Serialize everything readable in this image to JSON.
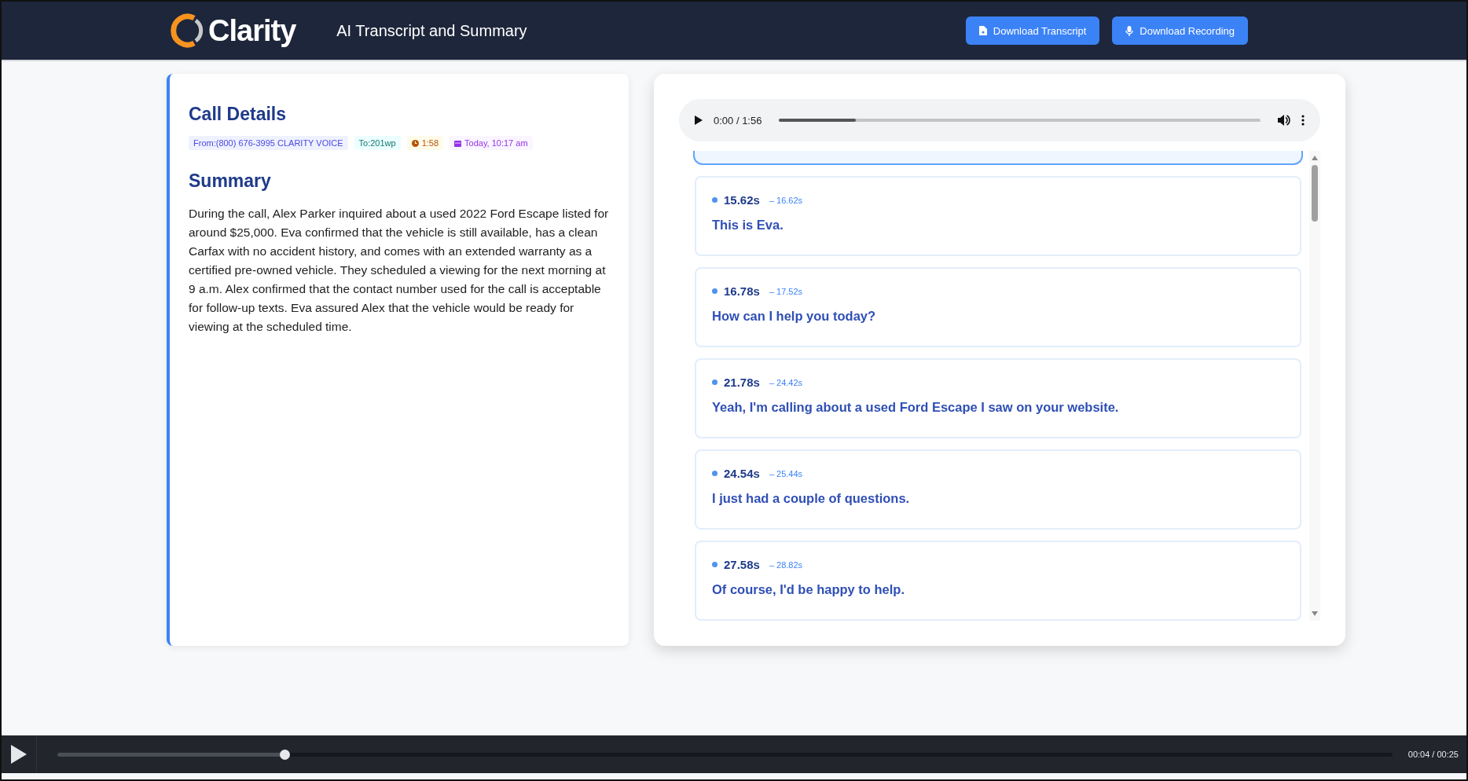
{
  "header": {
    "logo": "Clarity",
    "title": "AI Transcript and Summary",
    "buttons": [
      {
        "kind": "transcript",
        "label": "Download Transcript"
      },
      {
        "kind": "recording",
        "label": "Download Recording"
      }
    ]
  },
  "call_details": {
    "title": "Call Details",
    "badges": [
      {
        "kind": "from",
        "label": "From:(800) 676-3995 CLARITY VOICE"
      },
      {
        "kind": "to",
        "label": "To:201wp"
      },
      {
        "kind": "duration",
        "label": "1:58"
      },
      {
        "kind": "date",
        "label": "Today, 10:17 am"
      }
    ],
    "summary_title": "Summary",
    "summary": "During the call, Alex Parker inquired about a used 2022 Ford Escape listed for around $25,000. Eva confirmed that the vehicle is still available, has a clean Carfax with no accident history, and comes with an extended warranty as a certified pre-owned vehicle. They scheduled a viewing for the next morning at 9 a.m. Alex confirmed that the contact number used for the call is acceptable for follow-up texts. Eva assured Alex that the vehicle would be ready for viewing at the scheduled time."
  },
  "audio_player": {
    "time": "0:00 / 1:56",
    "level": 0.16
  },
  "transcript": [
    {
      "start": "15.62s",
      "end": "– 16.62s",
      "text": "This is Eva.",
      "selected": false
    },
    {
      "start": "16.78s",
      "end": "– 17.52s",
      "text": "How can I help you today?",
      "selected": false
    },
    {
      "start": "21.78s",
      "end": "– 24.42s",
      "text": "Yeah, I'm calling about a used Ford Escape I saw on your website.",
      "selected": false
    },
    {
      "start": "24.54s",
      "end": "– 25.44s",
      "text": "I just had a couple of questions.",
      "selected": false
    },
    {
      "start": "27.58s",
      "end": "– 28.82s",
      "text": "Of course, I'd be happy to help.",
      "selected": false
    }
  ],
  "video_bar": {
    "time": "00:04 / 00:25",
    "level": 0.17
  }
}
